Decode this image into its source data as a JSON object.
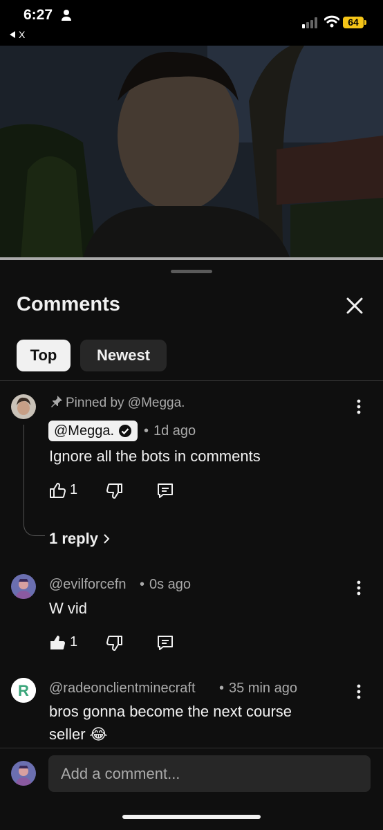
{
  "status_bar": {
    "time": "6:27",
    "back_label": "X",
    "battery": "64"
  },
  "comments_sheet": {
    "title": "Comments",
    "tabs": [
      {
        "label": "Top",
        "selected": true
      },
      {
        "label": "Newest",
        "selected": false
      }
    ],
    "comments": [
      {
        "pinned_label": "Pinned by @Megga.",
        "author": "@Megga.",
        "time": "1d ago",
        "text": "Ignore all the bots in comments",
        "likes": "1",
        "replies_label": "1 reply"
      },
      {
        "author": "@evilforcefn",
        "time": "0s ago",
        "text": "W vid",
        "likes": "1"
      },
      {
        "author": "@radeonclientminecraft",
        "time": "35 min ago",
        "text_line1": "bros gonna become the next course",
        "text_line2": "seller 😂"
      }
    ],
    "input_placeholder": "Add a comment..."
  }
}
